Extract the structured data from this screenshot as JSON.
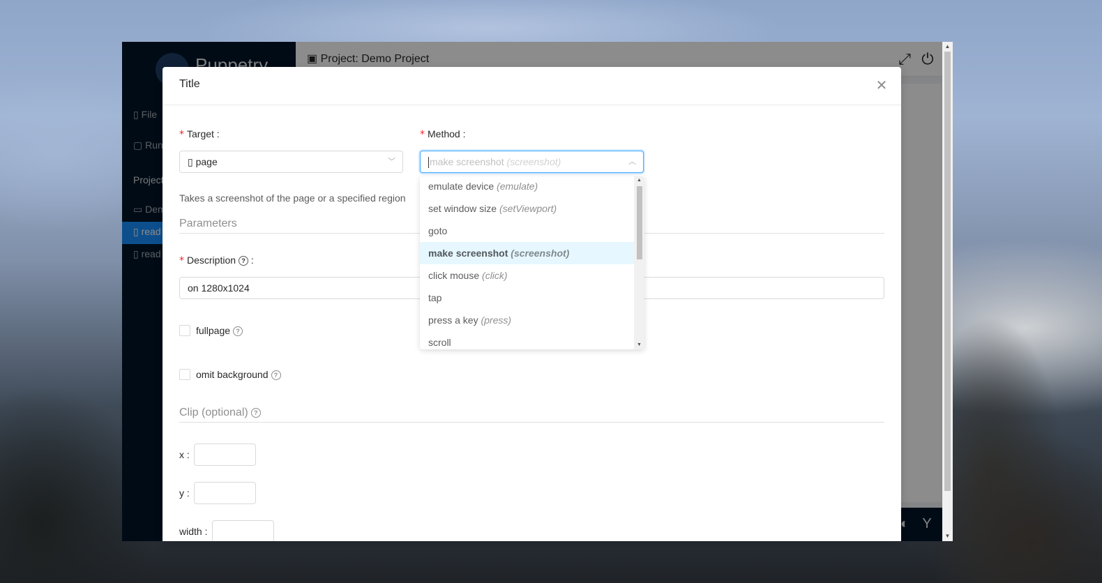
{
  "app": {
    "logo_text": "Puppetry",
    "menu": [
      "File",
      "Run"
    ],
    "project_section": "Project",
    "tree_items": [
      "Demo",
      "read",
      "read"
    ],
    "header_title": "Project: Demo Project",
    "icons": {
      "project": "project-icon",
      "fullscreen": "expand-icon",
      "power": "power-icon",
      "github": "github-icon",
      "fork": "fork-icon"
    }
  },
  "modal": {
    "title": "Title",
    "target": {
      "label": "Target",
      "value": "page",
      "icon": "file-icon"
    },
    "method": {
      "label": "Method",
      "placeholder": "make screenshot",
      "placeholder_hint": "(screenshot)"
    },
    "description_text": "Takes a screenshot of the page or a specified region",
    "parameters_title": "Parameters",
    "description_field": {
      "label": "Description",
      "value": "on 1280x1024"
    },
    "fullpage_label": "fullpage",
    "omit_background_label": "omit background",
    "clip_title": "Clip (optional)",
    "clip_fields": {
      "x": "x",
      "y": "y",
      "width": "width"
    }
  },
  "dropdown": {
    "options": [
      {
        "name": "emulate device",
        "hint": "(emulate)"
      },
      {
        "name": "set window size",
        "hint": "(setViewport)"
      },
      {
        "name": "goto",
        "hint": ""
      },
      {
        "name": "make screenshot",
        "hint": "(screenshot)",
        "selected": true
      },
      {
        "name": "click mouse",
        "hint": "(click)"
      },
      {
        "name": "tap",
        "hint": ""
      },
      {
        "name": "press a key",
        "hint": "(press)"
      },
      {
        "name": "scroll",
        "hint": ""
      }
    ]
  },
  "colors": {
    "primary": "#1890ff",
    "selected_bg": "#e6f7ff",
    "required": "#f5222d",
    "sider": "#001529"
  }
}
